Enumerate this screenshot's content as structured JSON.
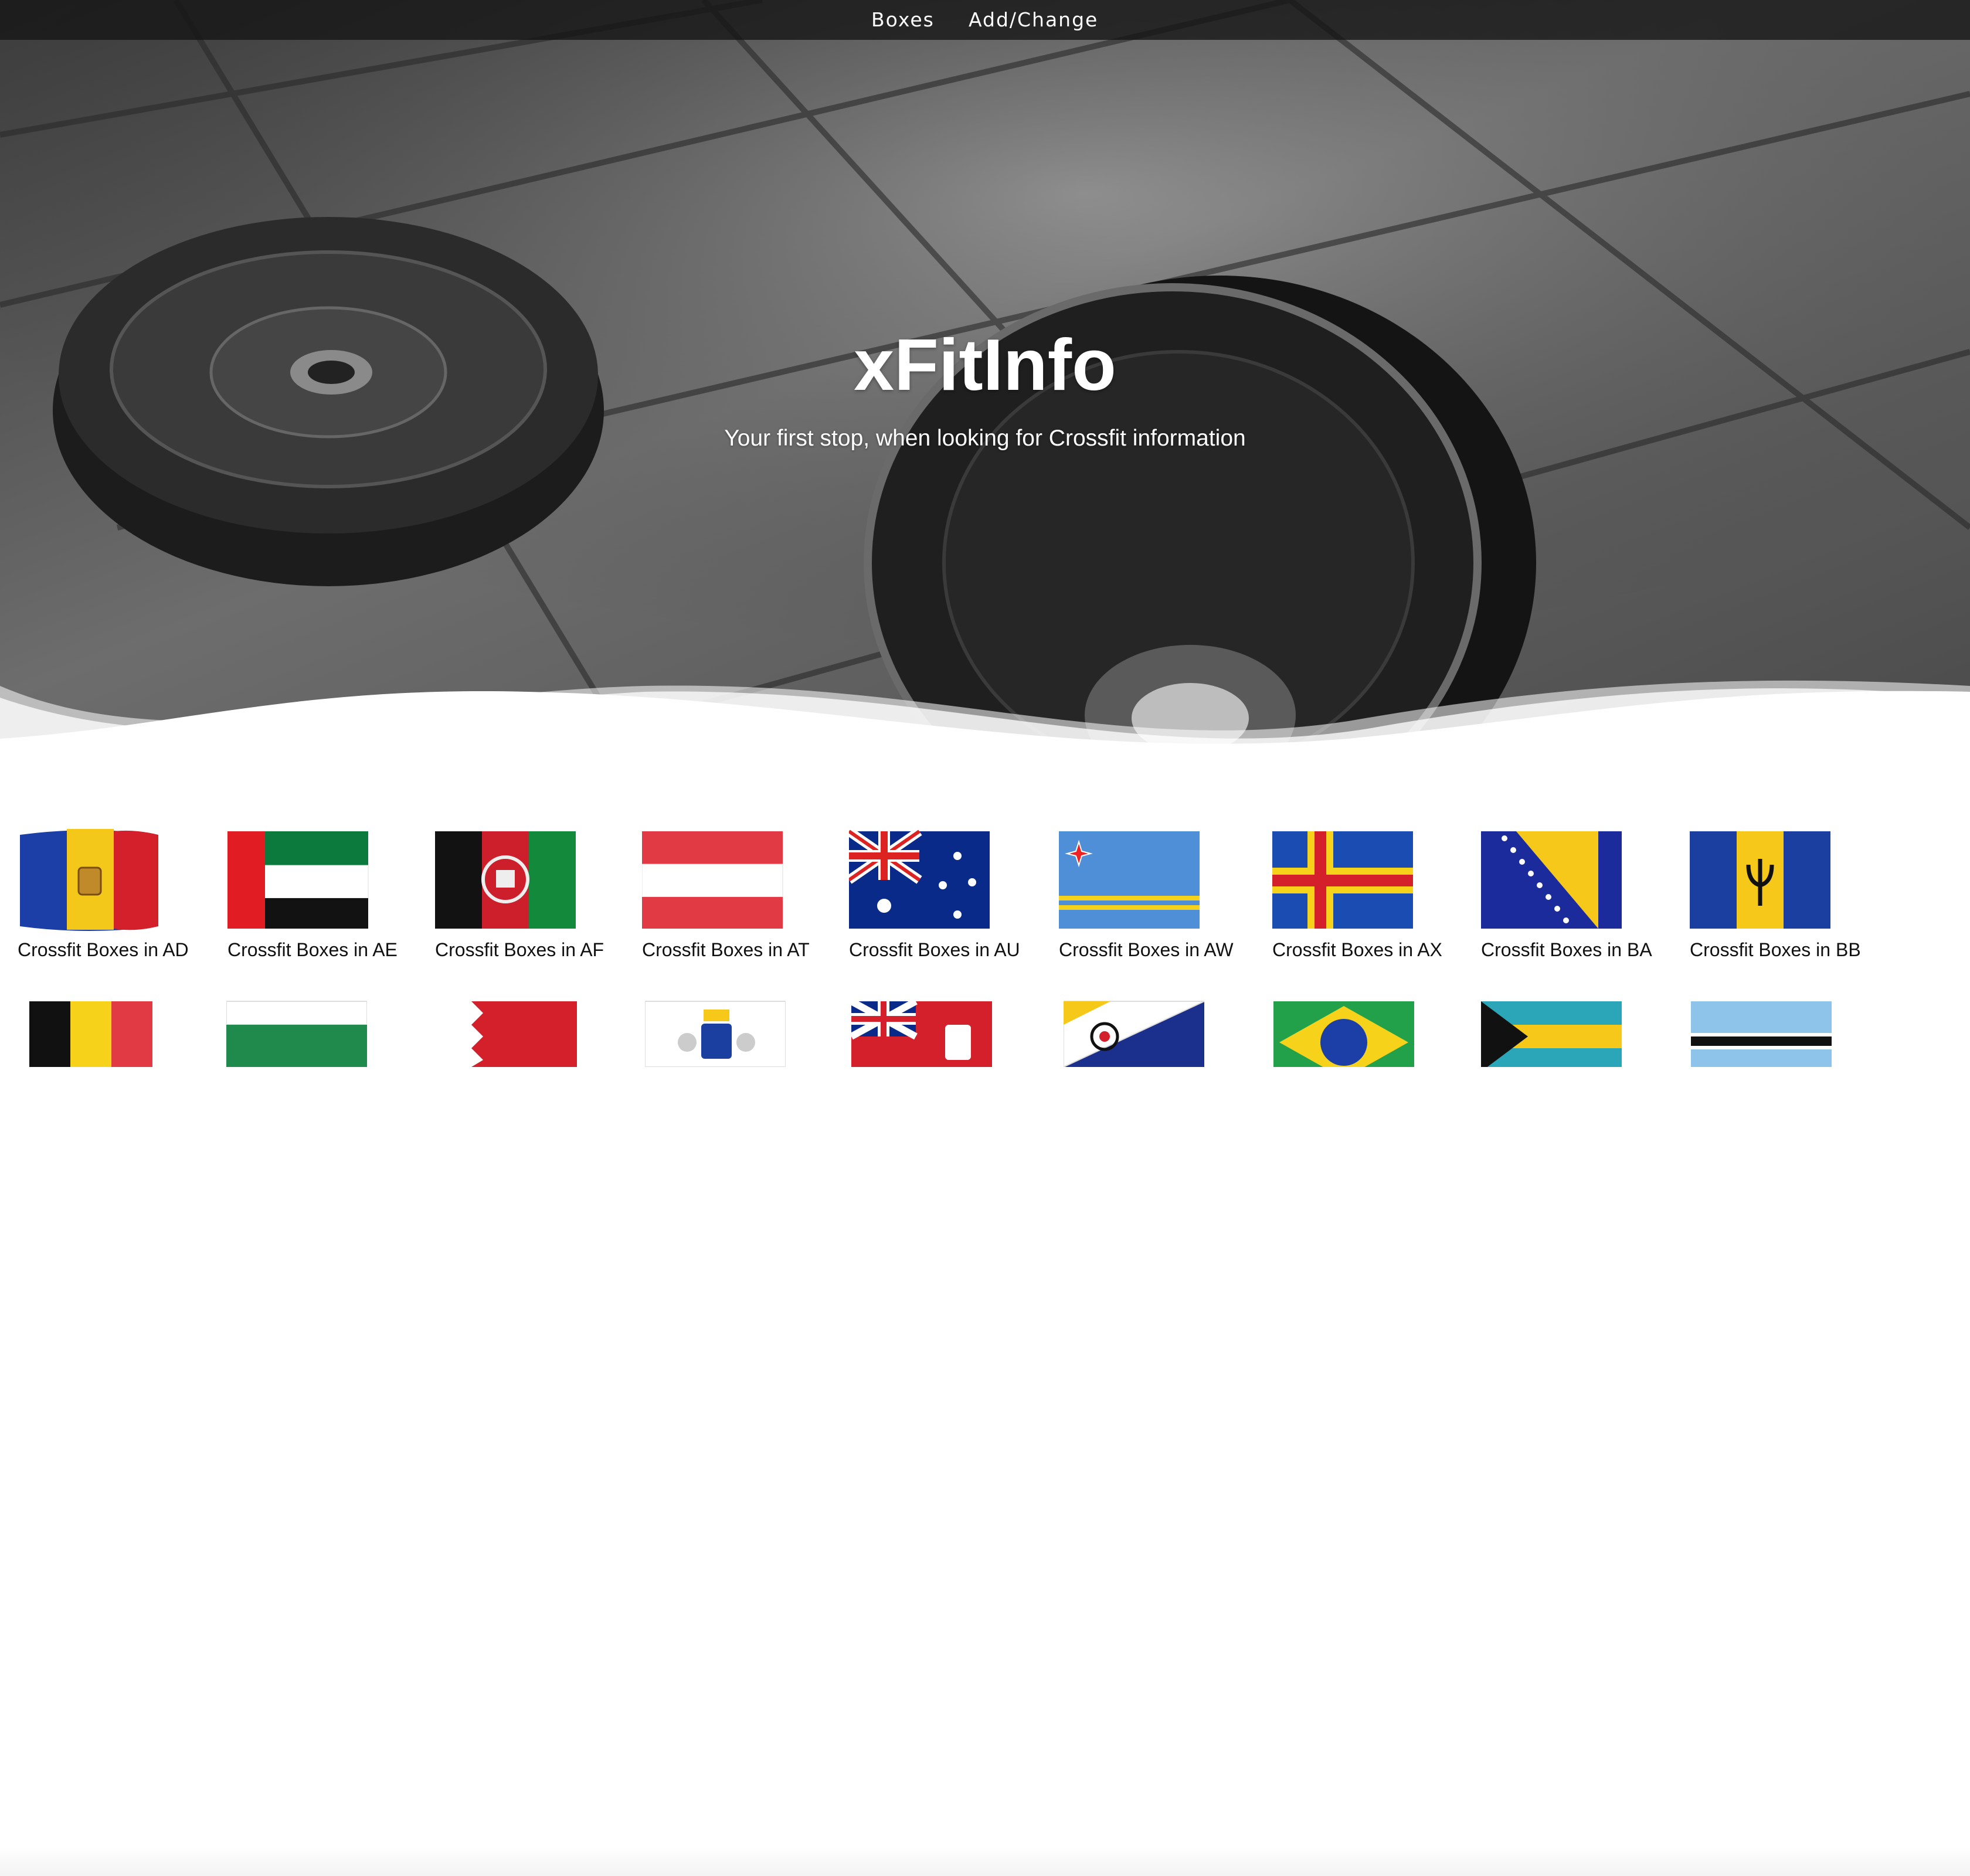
{
  "nav": {
    "items": [
      {
        "label": "Boxes"
      },
      {
        "label": "Add/Change"
      }
    ]
  },
  "hero": {
    "title": "xFitInfo",
    "tagline": "Your first stop, when looking for Crossfit information"
  },
  "countries": [
    {
      "code": "AD",
      "label": "Crossfit Boxes in AD",
      "flag_icon": "andorra-flag-icon"
    },
    {
      "code": "AE",
      "label": "Crossfit Boxes in AE",
      "flag_icon": "uae-flag-icon"
    },
    {
      "code": "AF",
      "label": "Crossfit Boxes in AF",
      "flag_icon": "afghanistan-flag-icon"
    },
    {
      "code": "AT",
      "label": "Crossfit Boxes in AT",
      "flag_icon": "austria-flag-icon"
    },
    {
      "code": "AU",
      "label": "Crossfit Boxes in AU",
      "flag_icon": "australia-flag-icon"
    },
    {
      "code": "AW",
      "label": "Crossfit Boxes in AW",
      "flag_icon": "aruba-flag-icon"
    },
    {
      "code": "AX",
      "label": "Crossfit Boxes in AX",
      "flag_icon": "aland-flag-icon"
    },
    {
      "code": "BA",
      "label": "Crossfit Boxes in BA",
      "flag_icon": "bosnia-flag-icon"
    },
    {
      "code": "BB",
      "label": "Crossfit Boxes in BB",
      "flag_icon": "barbados-flag-icon"
    }
  ],
  "second_row_flags": [
    {
      "flag_icon": "belgium-flag-icon"
    },
    {
      "flag_icon": "bulgaria-flag-icon"
    },
    {
      "flag_icon": "bahrain-flag-icon"
    },
    {
      "flag_icon": "saint-barthelemy-flag-icon"
    },
    {
      "flag_icon": "bermuda-flag-icon"
    },
    {
      "flag_icon": "caribbean-netherlands-flag-icon"
    },
    {
      "flag_icon": "brazil-flag-icon"
    },
    {
      "flag_icon": "bahamas-flag-icon"
    },
    {
      "flag_icon": "botswana-flag-icon"
    }
  ]
}
